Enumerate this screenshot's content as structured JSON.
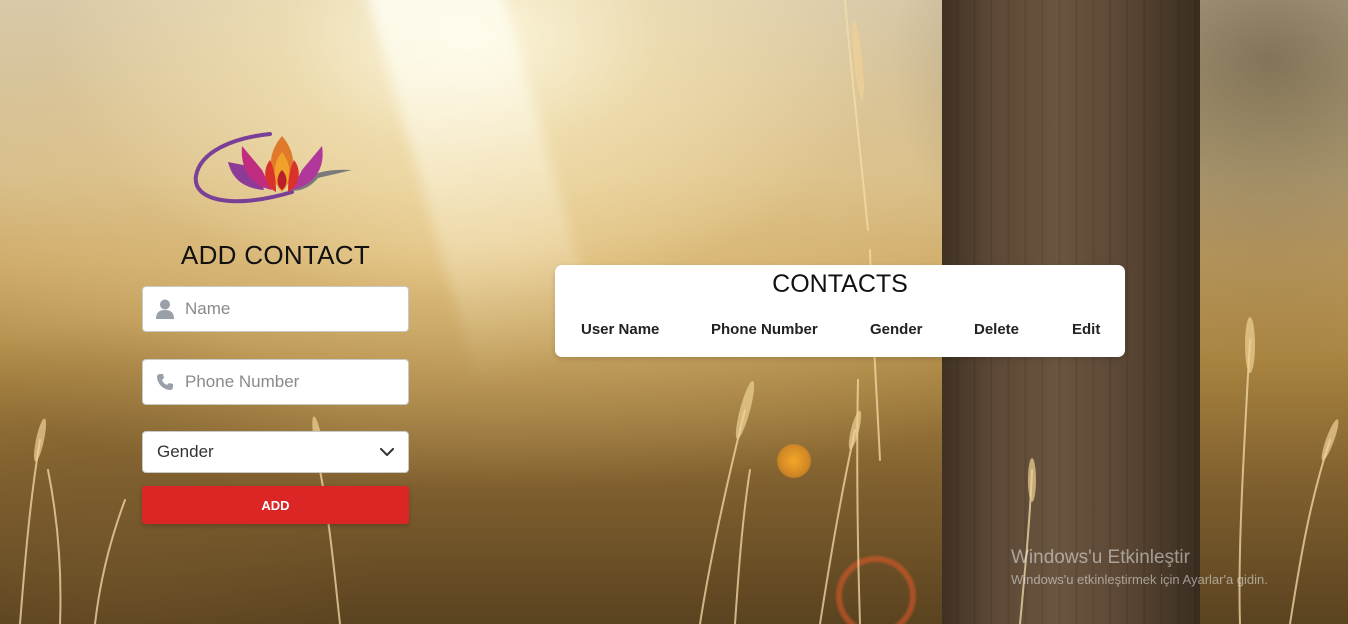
{
  "form": {
    "title": "ADD CONTACT",
    "name_placeholder": "Name",
    "phone_placeholder": "Phone Number",
    "gender_selected": "Gender",
    "add_label": "ADD",
    "name_icon": "user-icon",
    "phone_icon": "phone-icon",
    "accent_color": "#dc2626"
  },
  "contacts": {
    "title": "CONTACTS",
    "columns": [
      "User Name",
      "Phone Number",
      "Gender",
      "Delete",
      "Edit"
    ]
  },
  "watermark": {
    "line1": "Windows'u Etkinleştir",
    "line2": "Windows'u etkinleştirmek için Ayarlar'a gidin."
  }
}
